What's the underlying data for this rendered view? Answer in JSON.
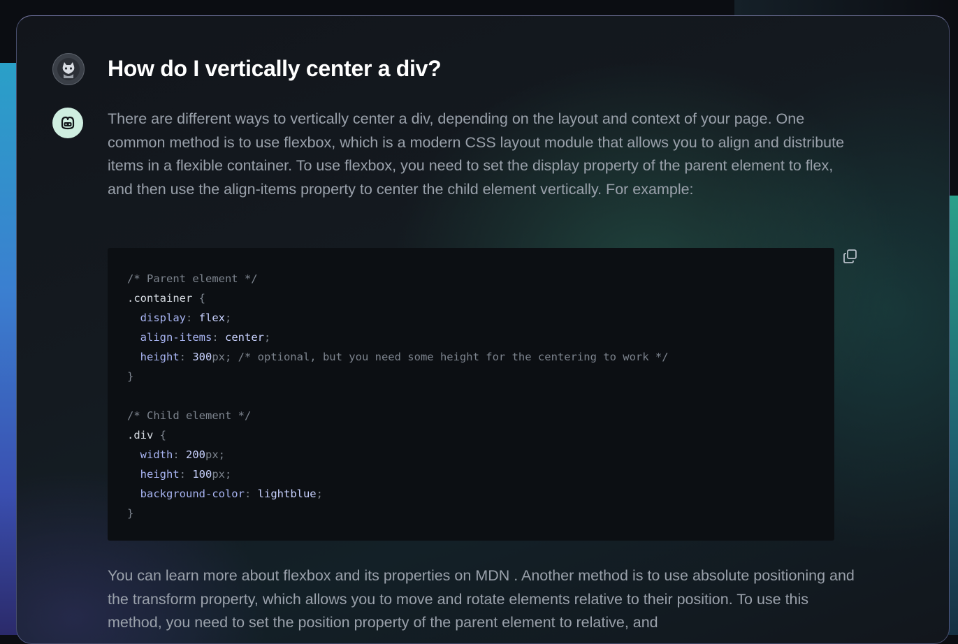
{
  "conversation": {
    "question": "How do I vertically center a div?",
    "answer_intro": "There are different ways to vertically center a div, depending on the layout and context of your page. One common method is to use flexbox, which is a modern CSS layout module that allows you to align and distribute items in a flexible container. To use flexbox, you need to set the display property of the parent element to flex, and then use the align-items property to center the child element vertically. For example:",
    "answer_followup": "You can learn more about flexbox and its properties on MDN . Another method is to use absolute positioning and the transform property, which allows you to move and rotate elements relative to their position. To use this method, you need to set the position property of the parent element to relative, and"
  },
  "code_block": {
    "lines": [
      [
        {
          "t": "/* Parent element */",
          "c": "comment"
        }
      ],
      [
        {
          "t": ".container",
          "c": "selector"
        },
        {
          "t": " {",
          "c": "punct"
        }
      ],
      [
        {
          "t": "  display",
          "c": "prop"
        },
        {
          "t": ": ",
          "c": "punct"
        },
        {
          "t": "flex",
          "c": "value"
        },
        {
          "t": ";",
          "c": "punct"
        }
      ],
      [
        {
          "t": "  align-items",
          "c": "prop"
        },
        {
          "t": ": ",
          "c": "punct"
        },
        {
          "t": "center",
          "c": "value"
        },
        {
          "t": ";",
          "c": "punct"
        }
      ],
      [
        {
          "t": "  height",
          "c": "prop"
        },
        {
          "t": ": ",
          "c": "punct"
        },
        {
          "t": "300",
          "c": "value"
        },
        {
          "t": "px; ",
          "c": "punct"
        },
        {
          "t": "/* optional, but you need some height for the centering to work */",
          "c": "comment"
        }
      ],
      [
        {
          "t": "}",
          "c": "punct"
        }
      ],
      [],
      [
        {
          "t": "/* Child element */",
          "c": "comment"
        }
      ],
      [
        {
          "t": ".div",
          "c": "selector"
        },
        {
          "t": " {",
          "c": "punct"
        }
      ],
      [
        {
          "t": "  width",
          "c": "prop"
        },
        {
          "t": ": ",
          "c": "punct"
        },
        {
          "t": "200",
          "c": "value"
        },
        {
          "t": "px;",
          "c": "punct"
        }
      ],
      [
        {
          "t": "  height",
          "c": "prop"
        },
        {
          "t": ": ",
          "c": "punct"
        },
        {
          "t": "100",
          "c": "value"
        },
        {
          "t": "px;",
          "c": "punct"
        }
      ],
      [
        {
          "t": "  background-color",
          "c": "prop"
        },
        {
          "t": ": ",
          "c": "punct"
        },
        {
          "t": "lightblue",
          "c": "value"
        },
        {
          "t": ";",
          "c": "punct"
        }
      ],
      [
        {
          "t": "}",
          "c": "punct"
        }
      ]
    ],
    "copy_icon": "copy-icon"
  },
  "icons": {
    "user_avatar": "octocat-avatar-icon",
    "bot_avatar": "copilot-icon"
  },
  "colors": {
    "comment": "#7d848e",
    "selector": "#d6dbe2",
    "prop": "#a8b4f2",
    "value": "#c9d2ff",
    "punct": "#7d848e",
    "bot_avatar_bg": "#cfeee0"
  }
}
